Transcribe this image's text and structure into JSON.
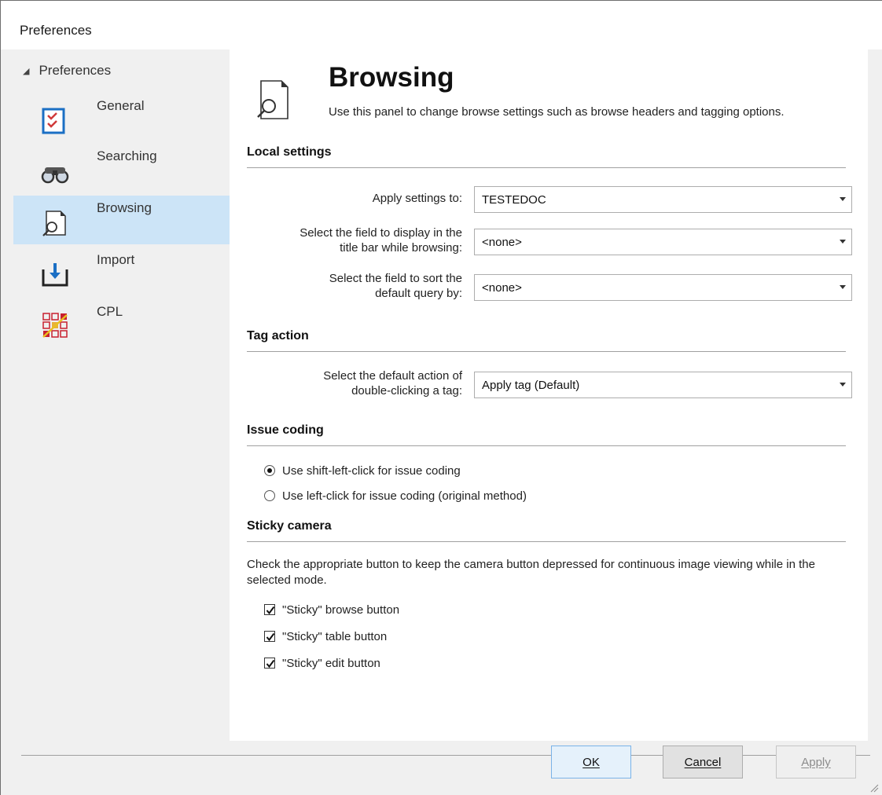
{
  "window": {
    "title": "Preferences"
  },
  "sidebar": {
    "root_label": "Preferences",
    "items": [
      {
        "label": "General",
        "icon": "checklist-icon",
        "selected": false
      },
      {
        "label": "Searching",
        "icon": "binoculars-icon",
        "selected": false
      },
      {
        "label": "Browsing",
        "icon": "document-search-icon",
        "selected": true
      },
      {
        "label": "Import",
        "icon": "import-icon",
        "selected": false
      },
      {
        "label": "CPL",
        "icon": "grid-icon",
        "selected": false
      }
    ]
  },
  "panel": {
    "title": "Browsing",
    "description": "Use this panel to change browse settings such as browse headers and tagging options.",
    "local_settings": {
      "heading": "Local settings",
      "apply_label": "Apply settings to:",
      "apply_value": "TESTEDOC",
      "title_field_label_1": "Select the field to display in the",
      "title_field_label_2": "title bar while browsing:",
      "title_field_value": "<none>",
      "sort_field_label_1": "Select the field to sort the",
      "sort_field_label_2": "default query by:",
      "sort_field_value": "<none>"
    },
    "tag_action": {
      "heading": "Tag action",
      "label_1": "Select the default action of",
      "label_2": "double-clicking a tag:",
      "value": "Apply tag (Default)"
    },
    "issue_coding": {
      "heading": "Issue coding",
      "option_shift": "Use shift-left-click for issue coding",
      "option_left": "Use left-click for issue coding (original method)",
      "selected": "shift"
    },
    "sticky_camera": {
      "heading": "Sticky camera",
      "note": "Check the appropriate button to keep the camera button depressed for continuous image viewing while in the selected mode.",
      "browse_label": "\"Sticky\" browse button",
      "table_label": "\"Sticky\" table button",
      "edit_label": "\"Sticky\" edit button",
      "browse_checked": true,
      "table_checked": true,
      "edit_checked": true
    }
  },
  "buttons": {
    "ok": "OK",
    "cancel": "Cancel",
    "apply": "Apply"
  }
}
